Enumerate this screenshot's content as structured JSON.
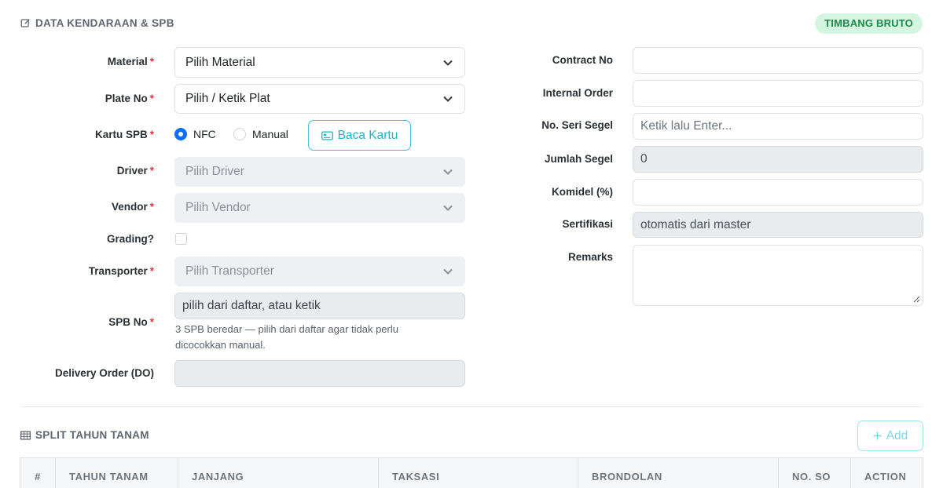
{
  "section1": {
    "title": "DATA KENDARAAN & SPB",
    "badge": "TIMBANG BRUTO",
    "left": {
      "material": {
        "label": "Material",
        "value": "Pilih Material"
      },
      "plate": {
        "label": "Plate No",
        "value": "Pilih / Ketik Plat"
      },
      "kartu": {
        "label": "Kartu SPB",
        "opt1": "NFC",
        "opt2": "Manual",
        "button": "Baca Kartu",
        "selected": "NFC"
      },
      "driver": {
        "label": "Driver",
        "value": "Pilih Driver"
      },
      "vendor": {
        "label": "Vendor",
        "value": "Pilih Vendor"
      },
      "grading": {
        "label": "Grading?"
      },
      "transporter": {
        "label": "Transporter",
        "value": "Pilih Transporter"
      },
      "spb": {
        "label": "SPB No",
        "placeholder": "pilih dari daftar, atau ketik",
        "help": "3 SPB beredar — pilih dari daftar agar tidak perlu dicocokkan manual."
      },
      "do": {
        "label": "Delivery Order (DO)",
        "value": ""
      }
    },
    "right": {
      "contract": {
        "label": "Contract No",
        "value": ""
      },
      "internal": {
        "label": "Internal Order",
        "value": ""
      },
      "segel": {
        "label": "No. Seri Segel",
        "placeholder": "Ketik lalu Enter..."
      },
      "jumlah": {
        "label": "Jumlah Segel",
        "value": "0"
      },
      "komidel": {
        "label": "Komidel (%)",
        "value": ""
      },
      "sertifikasi": {
        "label": "Sertifikasi",
        "value": "otomatis dari master"
      },
      "remarks": {
        "label": "Remarks",
        "value": ""
      }
    },
    "required_mark": "*"
  },
  "section2": {
    "title": "SPLIT TAHUN TANAM",
    "add_button": "Add",
    "columns": [
      "#",
      "TAHUN TANAM",
      "JANJANG",
      "TAKSASI",
      "BRONDOLAN",
      "NO. SO",
      "ACTION"
    ]
  },
  "colors": {
    "accent": "#1bb5c9",
    "primary": "#0d6efd",
    "badge_bg": "#d4f5df",
    "badge_text": "#1d8a4a",
    "required": "#dc3545"
  }
}
